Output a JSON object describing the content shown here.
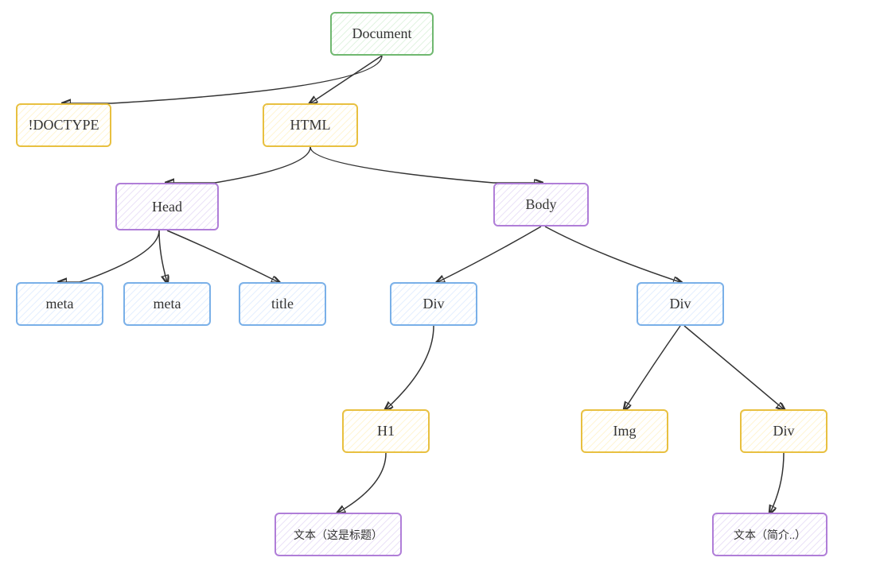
{
  "nodes": {
    "document": {
      "label": "Document"
    },
    "doctype": {
      "label": "!DOCTYPE"
    },
    "html": {
      "label": "HTML"
    },
    "head": {
      "label": "Head"
    },
    "body": {
      "label": "Body"
    },
    "meta1": {
      "label": "meta"
    },
    "meta2": {
      "label": "meta"
    },
    "title": {
      "label": "title"
    },
    "div1": {
      "label": "Div"
    },
    "div2": {
      "label": "Div"
    },
    "h1": {
      "label": "H1"
    },
    "img": {
      "label": "Img"
    },
    "div3": {
      "label": "Div"
    },
    "text1": {
      "label": "文本（这是标题）"
    },
    "text2": {
      "label": "文本（简介..）"
    }
  }
}
